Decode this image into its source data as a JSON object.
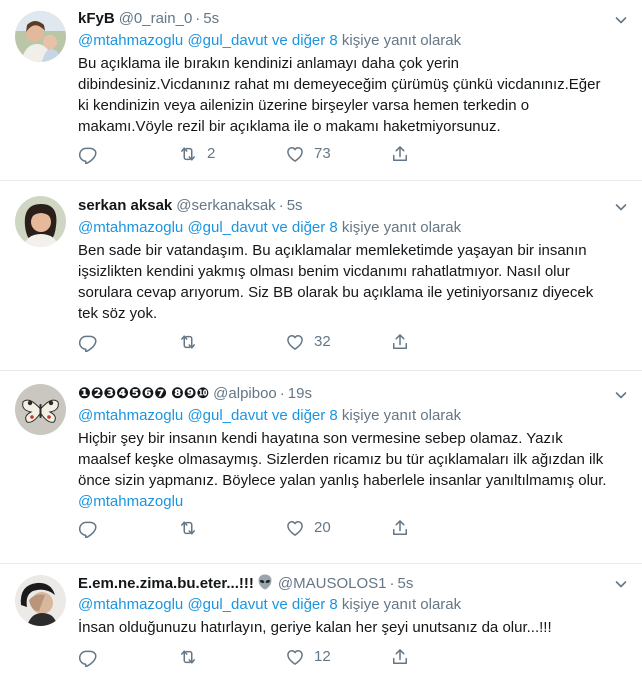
{
  "icons": {
    "reply": "reply-icon",
    "retweet": "retweet-icon",
    "like": "heart-icon",
    "share": "share-icon",
    "more": "chevron-down-icon"
  },
  "colors": {
    "link": "#1b95e0",
    "secondary": "#657786",
    "text": "#14171a",
    "divider": "#e6ecf0"
  },
  "tweets": [
    {
      "fullname": "kFyB",
      "username": "@0_rain_0",
      "dot": "·",
      "time": "5s",
      "reply_mentions": "@mtahmazoglu @gul_davut ve diğer 8",
      "reply_suffix": " kişiye yanıt olarak",
      "lines": [
        "Bu açıklama ile bırakın kendinizi anlamayı daha çok yerin",
        "dibindesiniz.Vicdanınız rahat mı demeyeceğim çürümüş çünkü vicdanınız.Eğer",
        "ki kendinizin veya ailenizin üzerine birşeyler varsa hemen terkedin o",
        "makamı.Vöyle rezil bir açıklama ile o makamı haketmiyorsunuz."
      ],
      "trailing_mention": "",
      "reply_count": "",
      "retweet_count": "2",
      "like_count": "73"
    },
    {
      "fullname": "serkan aksak",
      "username": "@serkanaksak",
      "dot": "·",
      "time": "5s",
      "reply_mentions": "@mtahmazoglu @gul_davut ve diğer 8",
      "reply_suffix": " kişiye yanıt olarak",
      "lines": [
        "Ben sade bir vatandaşım. Bu açıklamalar memleketimde yaşayan bir insanın",
        "işsizlikten kendini yakmış olması benim vicdanımı rahatlatmıyor. Nasıl olur",
        "sorulara cevap arıyorum. Siz BB olarak bu açıklama ile yetiniyorsanız diyecek",
        "tek söz yok."
      ],
      "trailing_mention": "",
      "reply_count": "",
      "retweet_count": "",
      "like_count": "32"
    },
    {
      "fullname": "❶❷❸❹❺❻❼ ❽❾❿",
      "username": "@alpiboo",
      "dot": "·",
      "time": "19s",
      "reply_mentions": "@mtahmazoglu @gul_davut ve diğer 8",
      "reply_suffix": " kişiye yanıt olarak",
      "lines": [
        "Hiçbir şey bir insanın kendi hayatına son vermesine sebep olamaz. Yazık",
        "maalsef keşke olmasaymış. Sizlerden ricamız bu tür açıklamaları ilk ağızdan ilk",
        "önce sizin yapmanız. Böylece yalan yanlış haberlele insanlar yanıltılmamış olur."
      ],
      "trailing_mention": "@mtahmazoglu",
      "reply_count": "",
      "retweet_count": "",
      "like_count": "20"
    },
    {
      "fullname": "E.em.ne.zima.bu.eter...!!!",
      "username": "@MAUSOLOS1",
      "dot": "·",
      "time": "5s",
      "reply_mentions": "@mtahmazoglu @gul_davut ve diğer 8",
      "reply_suffix": " kişiye yanıt olarak",
      "lines": [
        "İnsan olduğunuzu hatırlayın, geriye kalan her şeyi unutsanız da olur...!!!"
      ],
      "trailing_mention": "",
      "reply_count": "",
      "retweet_count": "",
      "like_count": "12"
    }
  ]
}
